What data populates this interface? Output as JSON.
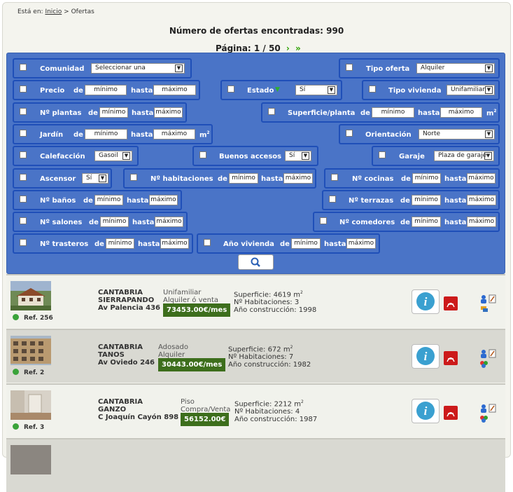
{
  "breadcrumb": {
    "prefix": "Está en:",
    "home": "Inicio",
    "sep": ">",
    "current": "Ofertas"
  },
  "results": {
    "count_text": "Número de ofertas encontradas: 990",
    "page_text": "Página: 1 / 50",
    "next": "›",
    "last": "»"
  },
  "filters": {
    "comunidad": {
      "label": "Comunidad",
      "value": "Seleccionar una"
    },
    "tipo_oferta": {
      "label": "Tipo oferta",
      "value": "Alquiler"
    },
    "precio": {
      "label": "Precio",
      "de": "de",
      "min": "mínimo",
      "hasta": "hasta",
      "max": "máximo"
    },
    "estado": {
      "label": "Estado",
      "value": "Sí"
    },
    "tipo_vivienda": {
      "label": "Tipo vivienda",
      "value": "Unifamiliar"
    },
    "plantas": {
      "label": "Nº plantas",
      "de": "de",
      "min": "mínimo",
      "hasta": "hasta",
      "max": "máximo"
    },
    "superficie": {
      "label": "Superficie/planta",
      "de": "de",
      "min": "mínimo",
      "hasta": "hasta",
      "max": "máximo",
      "unit": "m",
      "unit_sup": "2"
    },
    "jardin": {
      "label": "Jardín",
      "de": "de",
      "min": "mínimo",
      "hasta": "hasta",
      "max": "máximo",
      "unit": "m",
      "unit_sup": "2"
    },
    "orientacion": {
      "label": "Orientación",
      "value": "Norte"
    },
    "calefaccion": {
      "label": "Calefacción",
      "value": "Gasoil"
    },
    "accesos": {
      "label": "Buenos accesos",
      "value": "Sí"
    },
    "garaje": {
      "label": "Garaje",
      "value": "Plaza de garaje"
    },
    "ascensor": {
      "label": "Ascensor",
      "value": "Sí"
    },
    "habitaciones": {
      "label": "Nº habitaciones",
      "de": "de",
      "min": "mínimo",
      "hasta": "hasta",
      "max": "máximo"
    },
    "cocinas": {
      "label": "Nº cocinas",
      "de": "de",
      "min": "mínimo",
      "hasta": "hasta",
      "max": "máximo"
    },
    "banos": {
      "label": "Nº baños",
      "de": "de",
      "min": "mínimo",
      "hasta": "hasta",
      "max": "máximo"
    },
    "terrazas": {
      "label": "Nº terrazas",
      "de": "de",
      "min": "mínimo",
      "hasta": "hasta",
      "max": "máximo"
    },
    "salones": {
      "label": "Nº salones",
      "de": "de",
      "min": "mínimo",
      "hasta": "hasta",
      "max": "máximo"
    },
    "comedores": {
      "label": "Nº comedores",
      "de": "de",
      "min": "mínimo",
      "hasta": "hasta",
      "max": "máximo"
    },
    "trasteros": {
      "label": "Nº trasteros",
      "de": "de",
      "min": "mínimo",
      "hasta": "hasta",
      "max": "máximo"
    },
    "ano": {
      "label": "Año vivienda",
      "de": "de",
      "min": "mínimo",
      "hasta": "hasta",
      "max": "máximo"
    }
  },
  "listings": [
    {
      "ref": "Ref. 256",
      "region": "CANTABRIA",
      "town": "SIERRAPANDO",
      "address": "Av Palencia 436",
      "type": "Unifamiliar",
      "offer": "Alquiler ó venta",
      "price": "73453.00€/mes",
      "superficie": "Superficie: 4619 m",
      "habitaciones": "Nº Habitaciones: 3",
      "ano": "Año construcción: 1998"
    },
    {
      "ref": "Ref. 2",
      "region": "CANTABRIA",
      "town": "TANOS",
      "address": "Av Oviedo 246",
      "type": "Adosado",
      "offer": "Alquiler",
      "price": "30443.00€/mes",
      "superficie": "Superficie: 672 m",
      "habitaciones": "Nº Habitaciones: 7",
      "ano": "Año construcción: 1982"
    },
    {
      "ref": "Ref. 3",
      "region": "CANTABRIA",
      "town": "GANZO",
      "address": "C Joaquín Cayón 898",
      "type": "Piso",
      "offer": "Compra/Venta",
      "price": "56152.00€",
      "superficie": "Superficie: 2212 m",
      "habitaciones": "Nº Habitaciones: 4",
      "ano": "Año construcción: 1987"
    }
  ],
  "colors": {
    "panel": "#4a74c7",
    "panel_border": "#1f4fb8",
    "price_bg": "#3d6e1c",
    "status_dot": "#3aa33a",
    "pager_arrow": "#2aa000"
  }
}
